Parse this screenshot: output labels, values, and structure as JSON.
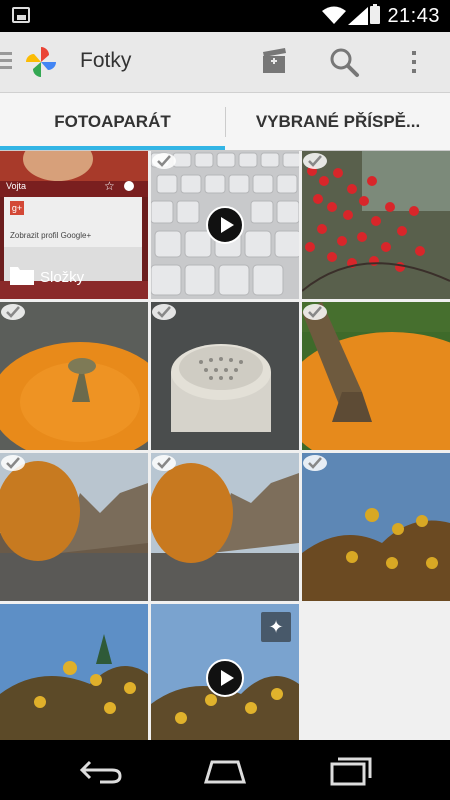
{
  "status": {
    "time": "21:43"
  },
  "appbar": {
    "title": "Fotky"
  },
  "tabs": [
    "FOTOAPARÁT",
    "VYBRANÉ PŘÍSPĚ..."
  ],
  "folder_tile": {
    "profile_name": "Vojta",
    "profile_link": "Zobrazit profil Google+",
    "folder_label": "Složky"
  },
  "colors": {
    "accent": "#33b5e5",
    "appbar": "#e9e9e9",
    "tabs": "#f5f5f5"
  }
}
